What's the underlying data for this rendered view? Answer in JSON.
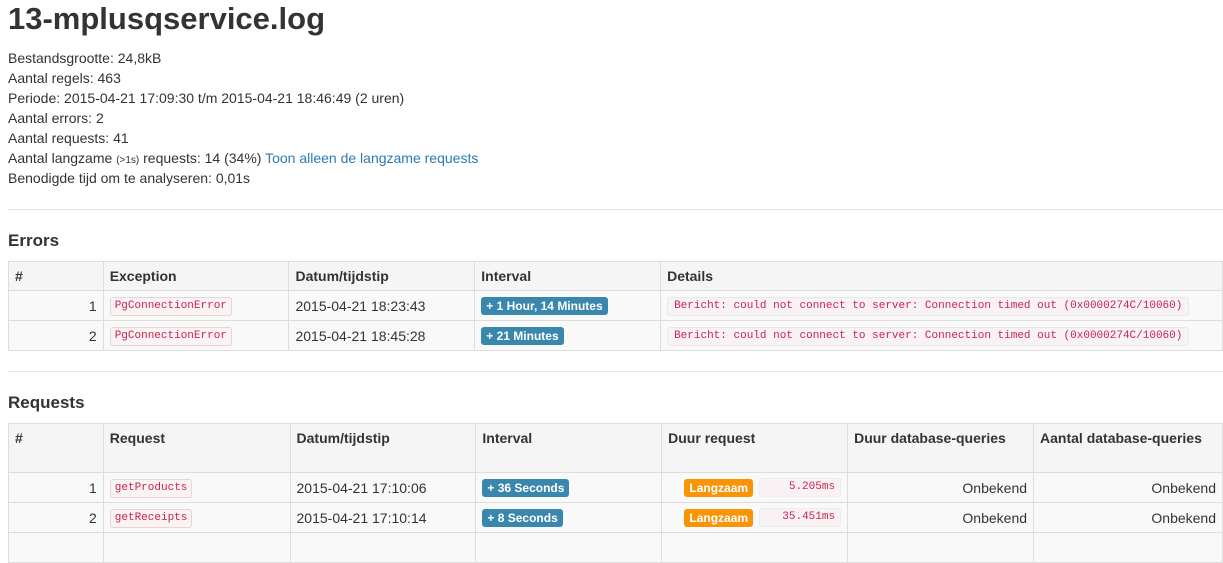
{
  "title": "13-mplusqservice.log",
  "summary": {
    "file_size_label": "Bestandsgrootte:",
    "file_size": "24,8kB",
    "lines_label": "Aantal regels:",
    "lines": "463",
    "period_label": "Periode:",
    "period": "2015-04-21 17:09:30 t/m 2015-04-21 18:46:49 (2 uren)",
    "errors_label": "Aantal errors:",
    "errors": "2",
    "requests_label": "Aantal requests:",
    "requests": "41",
    "slow_label_pre": "Aantal langzame",
    "slow_threshold": "(>1s)",
    "slow_label_post": "requests:",
    "slow_value": "14 (34%)",
    "slow_link": "Toon alleen de langzame requests",
    "analysis_label": "Benodigde tijd om te analyseren:",
    "analysis_time": "0,01s"
  },
  "errors_section": {
    "heading": "Errors",
    "columns": [
      "#",
      "Exception",
      "Datum/tijdstip",
      "Interval",
      "Details"
    ],
    "rows": [
      {
        "num": "1",
        "exception": "PgConnectionError",
        "datetime": "2015-04-21 18:23:43",
        "interval": "+ 1 Hour, 14 Minutes",
        "details": "Bericht: could not connect to server: Connection timed out (0x0000274C/10060)"
      },
      {
        "num": "2",
        "exception": "PgConnectionError",
        "datetime": "2015-04-21 18:45:28",
        "interval": "+ 21 Minutes",
        "details": "Bericht: could not connect to server: Connection timed out (0x0000274C/10060)"
      }
    ]
  },
  "requests_section": {
    "heading": "Requests",
    "columns": [
      "#",
      "Request",
      "Datum/tijdstip",
      "Interval",
      "Duur request",
      "Duur database-queries",
      "Aantal database-queries"
    ],
    "rows": [
      {
        "num": "1",
        "request": "getProducts",
        "datetime": "2015-04-21 17:10:06",
        "interval": "+ 36 Seconds",
        "status": "Langzaam",
        "duration": "5.205ms",
        "db_duration": "Onbekend",
        "db_count": "Onbekend"
      },
      {
        "num": "2",
        "request": "getReceipts",
        "datetime": "2015-04-21 17:10:14",
        "interval": "+ 8 Seconds",
        "status": "Langzaam",
        "duration": "35.451ms",
        "db_duration": "Onbekend",
        "db_count": "Onbekend"
      }
    ]
  },
  "colors": {
    "badge_blue": "#3a87ad",
    "badge_orange": "#f89406",
    "code_red": "#c7254e",
    "link": "#2a7ab7"
  }
}
